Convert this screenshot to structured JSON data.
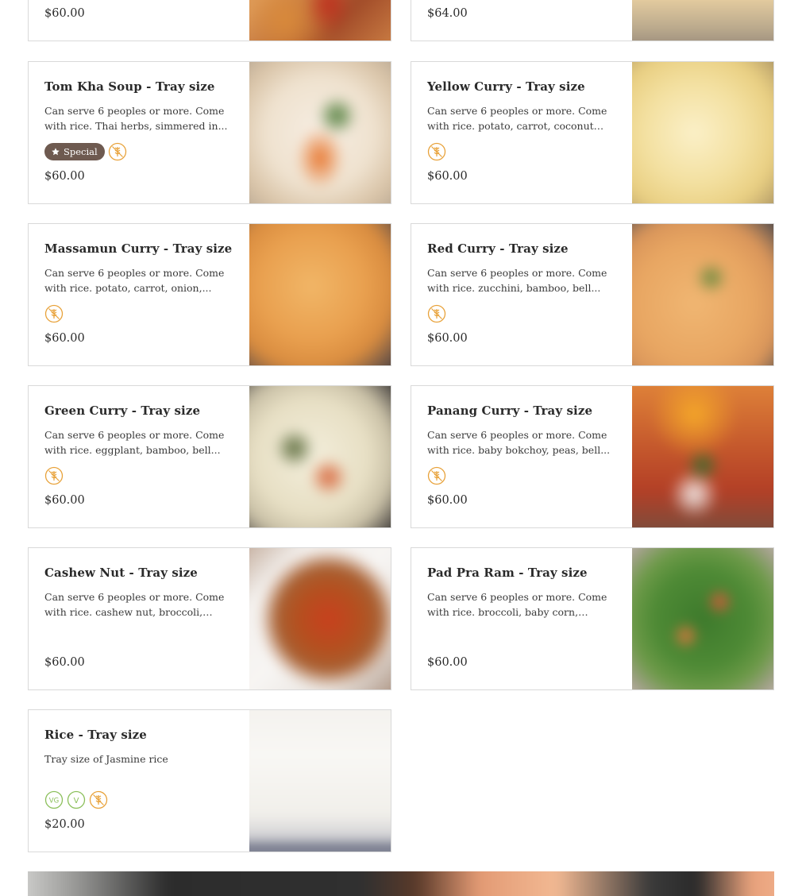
{
  "partial_cards": [
    {
      "price": "$60.00"
    },
    {
      "price": "$64.00"
    }
  ],
  "cards": [
    {
      "title": "Tom Kha Soup - Tray size",
      "description": "Can serve 6 peoples or more. Come with rice. Thai herbs, simmered in...",
      "special_label": "Special",
      "diet": [
        "gluten-free"
      ],
      "price": "$60.00"
    },
    {
      "title": "Yellow Curry - Tray size",
      "description": "Can serve 6 peoples or more. Come with rice. potato, carrot, coconut milk.",
      "diet": [
        "gluten-free"
      ],
      "price": "$60.00"
    },
    {
      "title": "Massamun Curry - Tray size",
      "description": "Can serve 6 peoples or more. Come with rice. potato, carrot, onion,...",
      "diet": [
        "gluten-free"
      ],
      "price": "$60.00"
    },
    {
      "title": "Red Curry - Tray size",
      "description": "Can serve 6 peoples or more. Come with rice. zucchini, bamboo, bell...",
      "diet": [
        "gluten-free"
      ],
      "price": "$60.00"
    },
    {
      "title": "Green Curry - Tray size",
      "description": "Can serve 6 peoples or more. Come with rice. eggplant, bamboo, bell...",
      "diet": [
        "gluten-free"
      ],
      "price": "$60.00"
    },
    {
      "title": "Panang Curry - Tray size",
      "description": "Can serve 6 peoples or more. Come with rice. baby bokchoy, peas, bell...",
      "diet": [
        "gluten-free"
      ],
      "price": "$60.00"
    },
    {
      "title": "Cashew Nut - Tray size",
      "description": "Can serve 6 peoples or more. Come with rice. cashew nut, broccoli, carr...",
      "diet": [],
      "price": "$60.00"
    },
    {
      "title": "Pad Pra Ram - Tray size",
      "description": "Can serve 6 peoples or more. Come with rice. broccoli, baby corn, carrot,...",
      "diet": [],
      "price": "$60.00"
    },
    {
      "title": "Rice - Tray size",
      "description": "Tray size of Jasmine rice",
      "diet": [
        "vegan",
        "vegetarian",
        "gluten-free"
      ],
      "vegan_label": "VG",
      "vegetarian_label": "V",
      "price": "$20.00"
    }
  ],
  "icons": {
    "special": "star-icon",
    "gluten_free": "wheat-slash-icon",
    "vegan": "vegan-icon",
    "vegetarian": "vegetarian-icon"
  },
  "colors": {
    "special_badge_bg": "#6e5a50",
    "gluten_free": "#e8a23a",
    "vegan_vegetarian": "#8bbf5a",
    "card_border": "#d9d9d9"
  }
}
